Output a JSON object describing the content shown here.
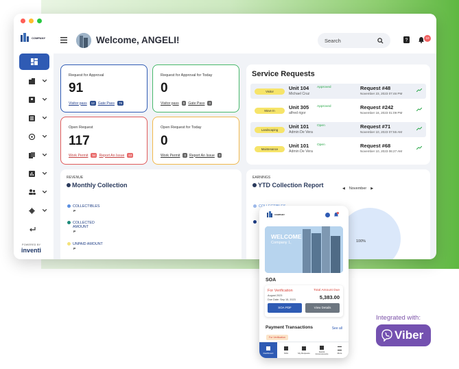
{
  "header": {
    "logo_text": "COMPANY",
    "welcome": "Welcome, ANGELI!",
    "search_placeholder": "Search",
    "notification_count": "10"
  },
  "sidebar": {
    "powered_by": "POWERED BY",
    "brand": "inventi"
  },
  "stats": [
    {
      "label": "Request for Approval",
      "value": "91",
      "link1": "Visitor pass",
      "badge1": "12",
      "link2": "Gate Pass",
      "badge2": "79",
      "color": "#2f5bb4"
    },
    {
      "label": "Request for Approval for Today",
      "value": "0",
      "link1": "Visitor pass",
      "badge1": "0",
      "link2": "Gate Pass",
      "badge2": "0",
      "color": "#47b86a"
    },
    {
      "label": "Open Request",
      "value": "117",
      "link1": "Work Permit",
      "badge1": "54",
      "link2": "Report An Issue",
      "badge2": "63",
      "color": "#e05a5a"
    },
    {
      "label": "Open Request for Today",
      "value": "0",
      "link1": "Work Permit",
      "badge1": "0",
      "link2": "Report An Issue",
      "badge2": "0",
      "color": "#f1b84a"
    }
  ],
  "service_requests": {
    "title": "Service Requests",
    "rows": [
      {
        "type": "Visitor",
        "unit": "Unit 104",
        "status": "Approved",
        "person": "Michael Cruz",
        "request": "Request #48",
        "date": "November 23, 2023 07:46 PM"
      },
      {
        "type": "Move In",
        "unit": "Unit 305",
        "status": "Approved",
        "person": "alfred rigor",
        "request": "Request #242",
        "date": "November 16, 2023 01:09 PM"
      },
      {
        "type": "Landscaping",
        "unit": "Unit 101",
        "status": "Open",
        "person": "Admin De Vera",
        "request": "Request #71",
        "date": "November 10, 2023 07:55 AM"
      },
      {
        "type": "Maintenance",
        "unit": "Unit 101",
        "status": "Open",
        "person": "Admin De Vera",
        "request": "Request #68",
        "date": "November 10, 2023 06:27 AM"
      }
    ]
  },
  "revenue": {
    "small": "REVENUE",
    "title": "Monthly Collection",
    "legend": [
      {
        "label": "COLLECTIBLES",
        "value": "P",
        "color": "#5b8fe0"
      },
      {
        "label": "COLLECTED AMOUNT",
        "value": "P",
        "color": "#1d8a7a"
      },
      {
        "label": "UNPAID AMOUNT",
        "value": "P",
        "color": "#f4e27a"
      }
    ]
  },
  "earnings": {
    "small": "EARNINGS",
    "title": "YTD Collection Report",
    "month": "November",
    "partial_legend": "COLLECTIBLES",
    "pie_label": "100%"
  },
  "phone": {
    "logo": "COMPANY",
    "hero_title": "WELCOME",
    "hero_sub": "Company 1,",
    "soa_title": "SOA",
    "status": "For Verification",
    "month": "August 2023",
    "due": "Due Date: Sep 15, 2023",
    "total_label": "Total Amount Due",
    "total": "5,383.00",
    "btn1": "SOA PDF",
    "btn2": "View Details",
    "payments_title": "Payment Transactions",
    "see_all": "See all",
    "payment_status": "For Verification",
    "nav": [
      "Dashboard",
      "SOA",
      "My Requests",
      "Special Announcements",
      "More"
    ]
  },
  "integration": {
    "label": "Integrated with:",
    "brand": "Viber"
  }
}
